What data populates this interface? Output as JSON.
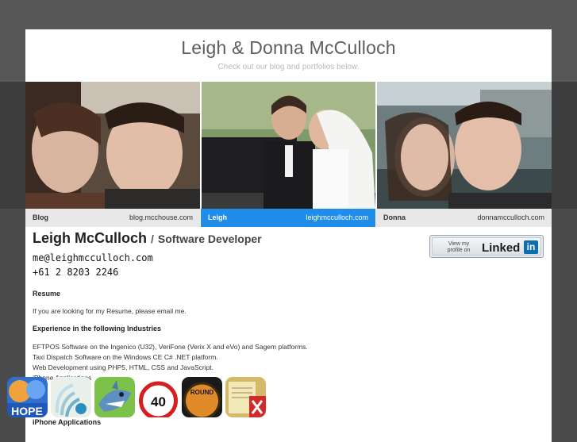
{
  "header": {
    "title": "Leigh & Donna McCulloch",
    "subtitle": "Check out our blog and portfolios below."
  },
  "tabs": [
    {
      "name": "Blog",
      "url": "blog.mcchouse.com",
      "active": false
    },
    {
      "name": "Leigh",
      "url": "leighmcculloch.com",
      "active": true
    },
    {
      "name": "Donna",
      "url": "donnamcculloch.com",
      "active": false
    }
  ],
  "profile": {
    "name": "Leigh McCulloch",
    "separator": "/",
    "job_title": "Software Developer",
    "email": "me@leighmcculloch.com",
    "phone": "+61 2 8203 2246"
  },
  "linkedin": {
    "small_text_1": "View my",
    "small_text_2": "profile on",
    "brand": "Linked",
    "brand_in": "in"
  },
  "sections": {
    "resume_heading": "Resume",
    "resume_text": "If you are looking for my Resume, please email me.",
    "experience_heading": "Experience in the following Industries",
    "experience_items": [
      "EFTPOS Software on the Ingenico (U32), VeriFone (Verix X and eVo) and Sagem platforms.",
      "Taxi Dispatch Software on the Windows CE C# .NET platform.",
      "Web Development using PHP5, HTML, CSS and JavaScript.",
      "iPhone Applications"
    ],
    "iphone_heading": "iPhone Applications"
  },
  "apps": [
    {
      "icon": "hope-app-icon",
      "label": "HOPE"
    },
    {
      "icon": "signal-app-icon",
      "label": ""
    },
    {
      "icon": "shark-app-icon",
      "label": ""
    },
    {
      "icon": "speed-sign-app-icon",
      "label": "40"
    },
    {
      "icon": "round-app-icon",
      "label": "ROUND"
    },
    {
      "icon": "notepad-app-icon",
      "label": ""
    }
  ],
  "colors": {
    "accent": "#1f8de9",
    "page_bg": "#4a4a4a",
    "panel_bg": "#ffffff"
  }
}
